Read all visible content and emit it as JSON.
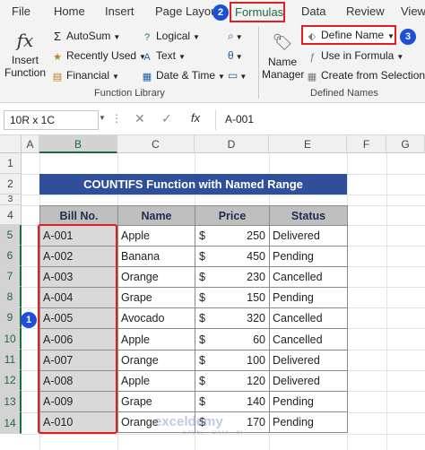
{
  "ribbon": {
    "tabs": [
      "File",
      "Home",
      "Insert",
      "Page Layout",
      "Formulas",
      "Data",
      "Review",
      "View"
    ],
    "insert_function": {
      "line1": "Insert",
      "line2": "Function"
    },
    "library": {
      "col1": [
        "AutoSum",
        "Recently Used",
        "Financial"
      ],
      "col2": [
        "Logical",
        "Text",
        "Date & Time"
      ],
      "group_label": "Function Library"
    },
    "name_manager": {
      "line1": "Name",
      "line2": "Manager"
    },
    "defined_names": {
      "define_name": "Define Name",
      "use_in_formula": "Use in Formula",
      "create_from_selection": "Create from Selection",
      "group_label": "Defined Names"
    }
  },
  "badges": {
    "one": "1",
    "two": "2",
    "three": "3"
  },
  "formula_bar": {
    "name_box": "10R x 1C",
    "fx": "fx",
    "value": "A-001"
  },
  "grid": {
    "columns": [
      "A",
      "B",
      "C",
      "D",
      "E",
      "F",
      "G"
    ],
    "rows": [
      "1",
      "2",
      "3",
      "4",
      "5",
      "6",
      "7",
      "8",
      "9",
      "10",
      "11",
      "12",
      "13",
      "14"
    ]
  },
  "sheet": {
    "title": "COUNTIFS Function with Named Range",
    "headers": [
      "Bill No.",
      "Name",
      "Price",
      "Status"
    ],
    "rows": [
      {
        "bill": "A-001",
        "name": "Apple",
        "currency": "$",
        "price": "250",
        "status": "Delivered"
      },
      {
        "bill": "A-002",
        "name": "Banana",
        "currency": "$",
        "price": "450",
        "status": "Pending"
      },
      {
        "bill": "A-003",
        "name": "Orange",
        "currency": "$",
        "price": "230",
        "status": "Cancelled"
      },
      {
        "bill": "A-004",
        "name": "Grape",
        "currency": "$",
        "price": "150",
        "status": "Pending"
      },
      {
        "bill": "A-005",
        "name": "Avocado",
        "currency": "$",
        "price": "320",
        "status": "Cancelled"
      },
      {
        "bill": "A-006",
        "name": "Apple",
        "currency": "$",
        "price": "60",
        "status": "Cancelled"
      },
      {
        "bill": "A-007",
        "name": "Orange",
        "currency": "$",
        "price": "100",
        "status": "Delivered"
      },
      {
        "bill": "A-008",
        "name": "Apple",
        "currency": "$",
        "price": "120",
        "status": "Delivered"
      },
      {
        "bill": "A-009",
        "name": "Grape",
        "currency": "$",
        "price": "140",
        "status": "Pending"
      },
      {
        "bill": "A-010",
        "name": "Orange",
        "currency": "$",
        "price": "170",
        "status": "Pending"
      }
    ]
  },
  "watermark": {
    "text": "exceldemy",
    "sub": "EXCEL · DATA · BI"
  },
  "colors": {
    "title_bg": "#2f4f9a",
    "header_bg": "#bfbfbf",
    "highlight": "#e02020",
    "badge": "#1d4fd8",
    "excel_green": "#1e6b3c"
  }
}
